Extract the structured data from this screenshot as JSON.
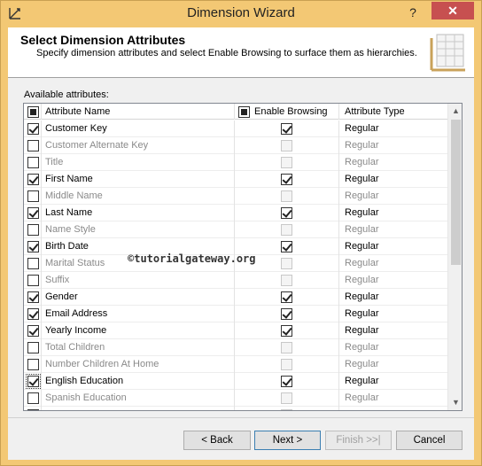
{
  "window": {
    "title": "Dimension Wizard",
    "help_glyph": "?",
    "close_glyph": "✕",
    "app_icon": "wizard-icon"
  },
  "header": {
    "title": "Select Dimension Attributes",
    "description": "Specify dimension attributes and select Enable Browsing to surface them as hierarchies."
  },
  "available_label": "Available attributes:",
  "grid": {
    "columns": {
      "name": "Attribute Name",
      "browse": "Enable Browsing",
      "type": "Attribute Type"
    },
    "rows": [
      {
        "name": "Customer Key",
        "selected": true,
        "browse": true,
        "type": "Regular"
      },
      {
        "name": "Customer Alternate Key",
        "selected": false,
        "browse": false,
        "type": "Regular"
      },
      {
        "name": "Title",
        "selected": false,
        "browse": false,
        "type": "Regular"
      },
      {
        "name": "First Name",
        "selected": true,
        "browse": true,
        "type": "Regular"
      },
      {
        "name": "Middle Name",
        "selected": false,
        "browse": false,
        "type": "Regular"
      },
      {
        "name": "Last Name",
        "selected": true,
        "browse": true,
        "type": "Regular"
      },
      {
        "name": "Name Style",
        "selected": false,
        "browse": false,
        "type": "Regular"
      },
      {
        "name": "Birth Date",
        "selected": true,
        "browse": true,
        "type": "Regular"
      },
      {
        "name": "Marital Status",
        "selected": false,
        "browse": false,
        "type": "Regular"
      },
      {
        "name": "Suffix",
        "selected": false,
        "browse": false,
        "type": "Regular"
      },
      {
        "name": "Gender",
        "selected": true,
        "browse": true,
        "type": "Regular"
      },
      {
        "name": "Email Address",
        "selected": true,
        "browse": true,
        "type": "Regular"
      },
      {
        "name": "Yearly Income",
        "selected": true,
        "browse": true,
        "type": "Regular"
      },
      {
        "name": "Total Children",
        "selected": false,
        "browse": false,
        "type": "Regular"
      },
      {
        "name": "Number Children At Home",
        "selected": false,
        "browse": false,
        "type": "Regular"
      },
      {
        "name": "English Education",
        "selected": true,
        "browse": true,
        "type": "Regular",
        "focused": true
      },
      {
        "name": "Spanish Education",
        "selected": false,
        "browse": false,
        "type": "Regular"
      },
      {
        "name": "French Education",
        "selected": false,
        "browse": false,
        "type": "Regular"
      }
    ]
  },
  "watermark": "©tutorialgateway.org",
  "buttons": {
    "back": "< Back",
    "next": "Next >",
    "finish": "Finish >>|",
    "cancel": "Cancel"
  },
  "colors": {
    "title_bar": "#f3c874",
    "close_button": "#c75050"
  }
}
